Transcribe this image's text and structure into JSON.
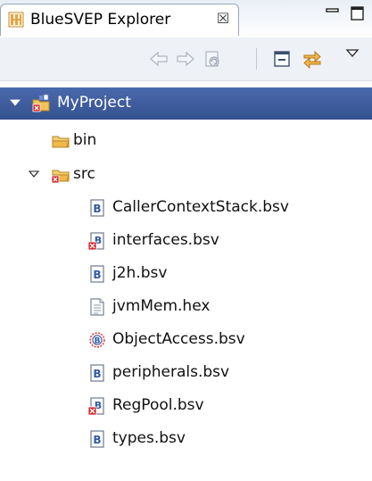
{
  "view": {
    "title": "BlueSVEP Explorer",
    "close_glyph": "☒",
    "buttons": {
      "minimize": "minimize-icon",
      "maximize": "maximize-icon"
    },
    "toolbar": {
      "back": "back-arrow-icon",
      "forward": "forward-arrow-icon",
      "refresh": "refresh-icon",
      "collapse_all": "collapse-all-icon",
      "link_editor": "link-with-editor-icon",
      "view_menu": "view-menu-icon"
    }
  },
  "tree": {
    "project": {
      "label": "MyProject",
      "expanded": true,
      "icon": "project-error-icon"
    },
    "bin": {
      "label": "bin",
      "icon": "folder-icon"
    },
    "src": {
      "label": "src",
      "expanded": true,
      "icon": "folder-error-icon"
    },
    "files": [
      {
        "label": "CallerContextStack.bsv",
        "icon": "bsv-file-icon"
      },
      {
        "label": "interfaces.bsv",
        "icon": "bsv-file-error-icon"
      },
      {
        "label": "j2h.bsv",
        "icon": "bsv-file-icon"
      },
      {
        "label": "jvmMem.hex",
        "icon": "text-file-icon"
      },
      {
        "label": "ObjectAccess.bsv",
        "icon": "bsv-object-icon"
      },
      {
        "label": "peripherals.bsv",
        "icon": "bsv-file-icon"
      },
      {
        "label": "RegPool.bsv",
        "icon": "bsv-file-error-icon"
      },
      {
        "label": "types.bsv",
        "icon": "bsv-file-icon"
      }
    ]
  },
  "colors": {
    "selection": "#3b5a9e",
    "folder": "#e8b04a",
    "bsv_blue": "#2f5aa8",
    "error_red": "#d2232a"
  }
}
